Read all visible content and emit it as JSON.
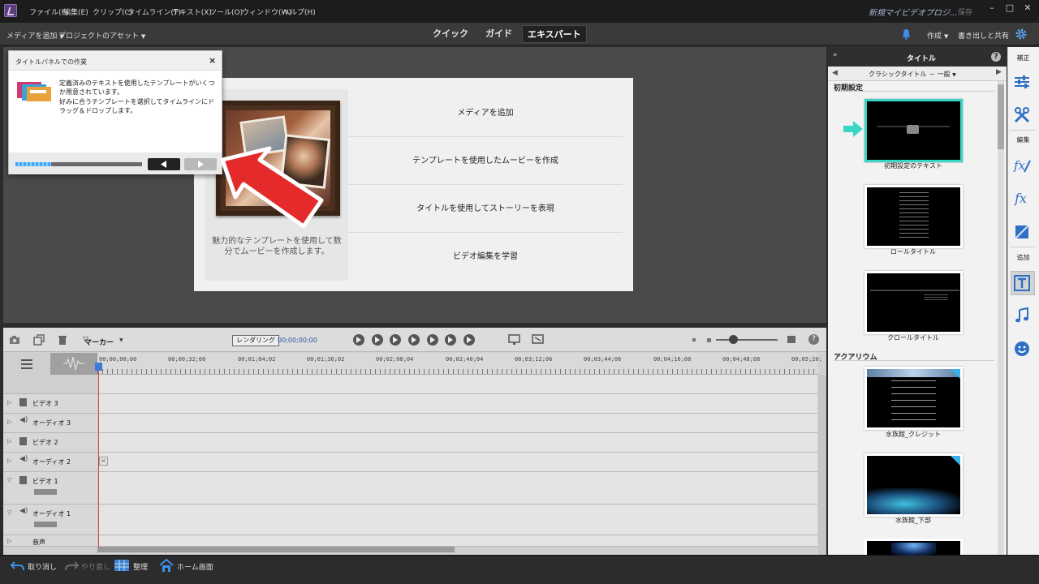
{
  "menubar": {
    "items": [
      "ファイル(F)",
      "編集(E)",
      "クリップ(C)",
      "タイムライン(T)",
      "テキスト(X)",
      "ツール(O)",
      "ウィンドウ(W)",
      "ヘルプ(H)"
    ],
    "doc_title": "新規マイビデオプロジ...",
    "save": "保存"
  },
  "toolbar": {
    "add_media": "メディアを追加",
    "project_assets": "プロジェクトのアセット",
    "tabs": [
      "クイック",
      "ガイド",
      "エキスパート"
    ],
    "active_tab": "エキスパート",
    "create": "作成",
    "export_share": "書き出しと共有"
  },
  "help_panel": {
    "title": "タイトルパネルでの作業",
    "close": "×",
    "text1": "定義済みのテキストを使用したテンプレートがいくつか用意されています。",
    "text2": "好みに合うテンプレートを選択してタイムラインにドラッグ＆ドロップします。",
    "progress": 0.28
  },
  "welcome": {
    "caption": "魅力的なテンプレートを使用して数分でムービーを作成します。",
    "rows": [
      "メディアを追加",
      "テンプレートを使用したムービーを作成",
      "タイトルを使用してストーリーを表現",
      "ビデオ編集を学習"
    ]
  },
  "timeline": {
    "marker": "マーカー",
    "render": "レンダリング",
    "current_time": "00;00;00;00",
    "ruler": [
      "00;00;00;00",
      "00;00;32;00",
      "00;01;04;02",
      "00;01;36;02",
      "00;02;08;04",
      "00;02;40;04",
      "00;03;12;06",
      "00;03;44;06",
      "00;04;16;08",
      "00;04;48;08",
      "00;05;20;"
    ],
    "tracks": [
      {
        "name": "ビデオ 3",
        "type": "video"
      },
      {
        "name": "オーディオ 3",
        "type": "audio"
      },
      {
        "name": "ビデオ 2",
        "type": "video"
      },
      {
        "name": "オーディオ 2",
        "type": "audio"
      },
      {
        "name": "ビデオ 1",
        "type": "video"
      },
      {
        "name": "オーディオ 1",
        "type": "audio"
      },
      {
        "name": "音声",
        "type": "voice"
      }
    ]
  },
  "bottombar": {
    "undo": "取り消し",
    "redo": "やり直し",
    "organize": "整理",
    "home": "ホーム画面"
  },
  "right_panel": {
    "title": "タイトル",
    "help": "?",
    "dropdown": "クラシックタイトル － 一般",
    "section_default": "初期設定",
    "section_aquarium": "アクアリウム",
    "thumbs": [
      {
        "label": "初期設定のテキスト"
      },
      {
        "label": "ロールタイトル"
      },
      {
        "label": "クロールタイトル"
      },
      {
        "label": "水族館_クレジット"
      },
      {
        "label": "水族館_下部"
      }
    ]
  },
  "rail": {
    "adjust": "補正",
    "edit": "編集",
    "add": "追加"
  },
  "colors": {
    "accent_cyan": "#39d5c5",
    "arrow_red": "#e42a2a",
    "timecode_blue": "#2c56a8",
    "rail_blue": "#2f6fc4"
  }
}
